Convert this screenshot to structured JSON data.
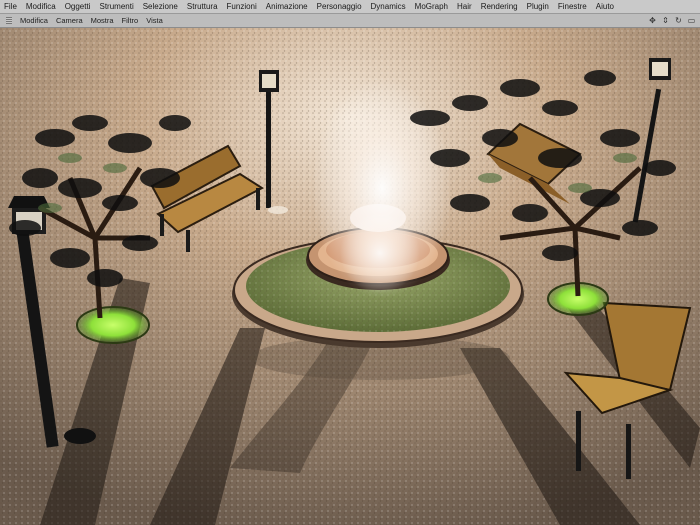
{
  "menubar": {
    "items": [
      "File",
      "Modifica",
      "Oggetti",
      "Strumenti",
      "Selezione",
      "Struttura",
      "Funzioni",
      "Animazione",
      "Personaggio",
      "Dynamics",
      "MoGraph",
      "Hair",
      "Rendering",
      "Plugin",
      "Finestre",
      "Aiuto"
    ]
  },
  "viewport_toolbar": {
    "items": [
      "Modifica",
      "Camera",
      "Mostra",
      "Filtro",
      "Vista"
    ],
    "controls": [
      "move-icon",
      "scroll-icon",
      "zoom-icon",
      "maximize-icon"
    ]
  },
  "scene": {
    "description_icons": [
      "fountain",
      "lamp-post",
      "bench",
      "tree"
    ]
  }
}
